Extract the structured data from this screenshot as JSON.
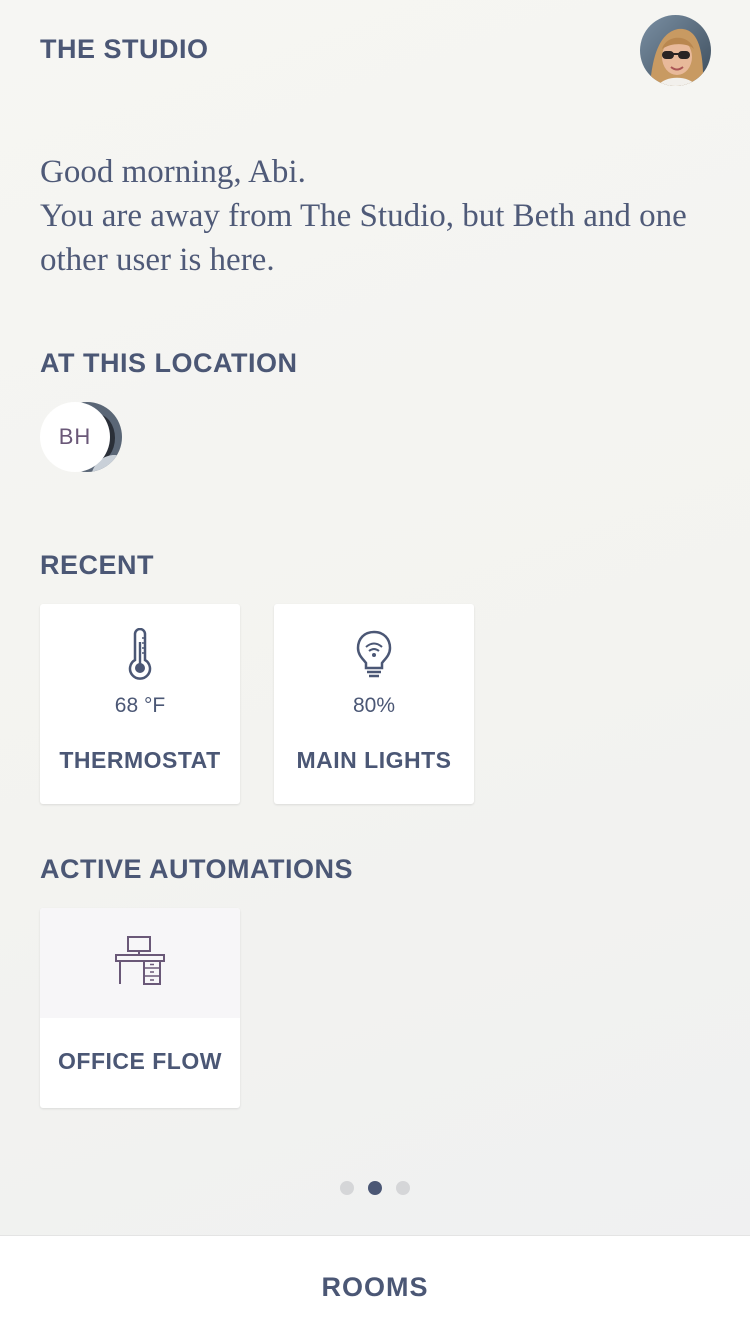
{
  "header": {
    "title": "THE STUDIO",
    "avatar_icon": "user-avatar-photo"
  },
  "greeting": {
    "line1": "Good morning, Abi.",
    "line2": "You are away from The Studio, but Beth and one other user is here."
  },
  "location": {
    "heading": "AT THIS LOCATION",
    "users": [
      {
        "initials": "BH"
      }
    ]
  },
  "recent": {
    "heading": "RECENT",
    "items": [
      {
        "value": "68 °F",
        "label": "THERMOSTAT",
        "icon": "thermometer-icon"
      },
      {
        "value": "80%",
        "label": "MAIN LIGHTS",
        "icon": "lightbulb-icon"
      }
    ]
  },
  "automations": {
    "heading": "ACTIVE AUTOMATIONS",
    "items": [
      {
        "label": "OFFICE FLOW",
        "icon": "desk-icon"
      }
    ]
  },
  "pager": {
    "pages": 3,
    "active_index": 1
  },
  "bottom_bar": {
    "label": "ROOMS"
  },
  "colors": {
    "text": "#4b5775",
    "icon_accent": "#6a5878",
    "dot_active": "#4b5775",
    "dot_inactive": "#d5d6d8"
  }
}
